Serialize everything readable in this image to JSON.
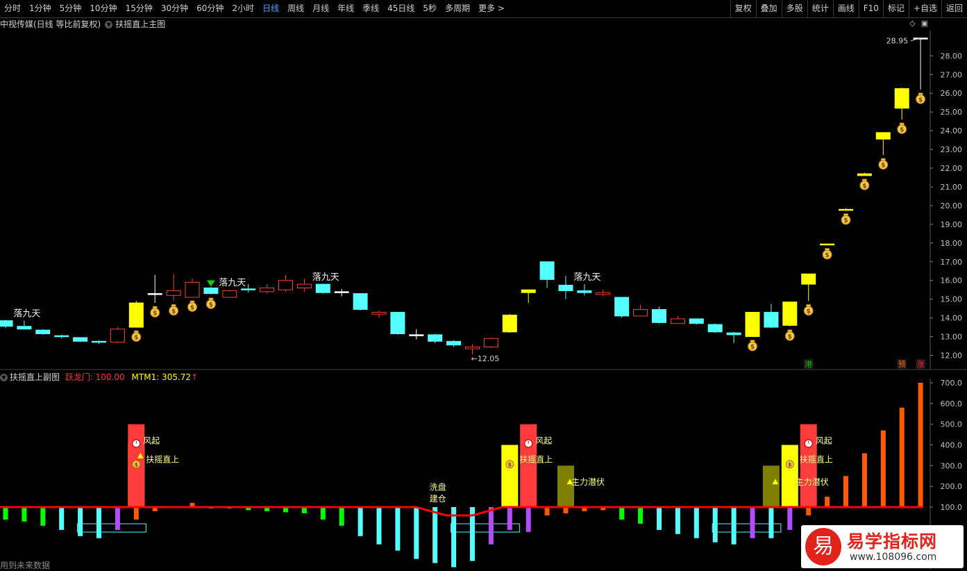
{
  "toolbar": {
    "periods": [
      "分时",
      "1分钟",
      "5分钟",
      "10分钟",
      "15分钟",
      "30分钟",
      "60分钟",
      "2小时",
      "日线",
      "周线",
      "月线",
      "年线",
      "季线",
      "45日线",
      "5秒",
      "多周期",
      "更多 >"
    ],
    "active_index": 8,
    "right_tools": [
      "复权",
      "叠加",
      "多股",
      "统计",
      "画线",
      "F10",
      "标记",
      "+自选",
      "返回"
    ]
  },
  "main_panel": {
    "title": "中视传媒(日线 等比前复权)",
    "indicator": "扶摇直上主图",
    "icons": [
      "diamond-icon",
      "restore-icon"
    ]
  },
  "sub_panel": {
    "title": "扶摇直上副图",
    "val1": "跃龙门: 100.00",
    "val2": "MTM1: 305.72",
    "val2_arrow": "↑"
  },
  "footer_note": "用到未来数据",
  "logo": {
    "char": "易",
    "name": "易学指标网",
    "url": "www.108096.com"
  },
  "colors": {
    "up": "#ff3c3c",
    "down": "#54ffff",
    "yellow": "#ffff00",
    "orange": "#ff5a00",
    "green": "#00ff00",
    "purple": "#b04dff",
    "olive": "#808000",
    "red": "#ff0000",
    "price_axis": "#c0c0c0"
  },
  "chart_data": [
    {
      "type": "candlestick",
      "title": "中视传媒(日线 等比前复权)",
      "ylim": [
        11.5,
        29.2
      ],
      "y_ticks": [
        "12.00",
        "13.00",
        "14.00",
        "15.00",
        "16.00",
        "17.00",
        "18.00",
        "19.00",
        "20.00",
        "21.00",
        "22.00",
        "23.00",
        "24.00",
        "25.00",
        "26.00",
        "27.00",
        "28.00"
      ],
      "candles": [
        {
          "o": 13.85,
          "h": 13.9,
          "l": 13.45,
          "c": 13.55,
          "color": "cyan"
        },
        {
          "o": 13.55,
          "h": 13.85,
          "l": 13.4,
          "c": 13.4,
          "color": "cyan"
        },
        {
          "o": 13.35,
          "h": 13.4,
          "l": 13.1,
          "c": 13.15,
          "color": "cyan"
        },
        {
          "o": 13.05,
          "h": 13.1,
          "l": 12.9,
          "c": 13.0,
          "color": "cyan"
        },
        {
          "o": 12.95,
          "h": 12.95,
          "l": 12.7,
          "c": 12.75,
          "color": "cyan"
        },
        {
          "o": 12.75,
          "h": 12.8,
          "l": 12.6,
          "c": 12.7,
          "color": "cyan"
        },
        {
          "o": 12.7,
          "h": 13.5,
          "l": 12.65,
          "c": 13.4,
          "color": "red"
        },
        {
          "o": 13.5,
          "h": 14.9,
          "l": 13.5,
          "c": 14.8,
          "color": "yellow"
        },
        {
          "o": 15.3,
          "h": 16.3,
          "l": 14.8,
          "c": 15.3,
          "color": "white"
        },
        {
          "o": 15.2,
          "h": 16.35,
          "l": 14.9,
          "c": 15.45,
          "color": "red"
        },
        {
          "o": 15.1,
          "h": 16.1,
          "l": 15.1,
          "c": 15.9,
          "color": "red"
        },
        {
          "o": 15.6,
          "h": 15.65,
          "l": 15.25,
          "c": 15.3,
          "color": "cyan"
        },
        {
          "o": 15.1,
          "h": 15.5,
          "l": 15.1,
          "c": 15.45,
          "color": "red"
        },
        {
          "o": 15.55,
          "h": 15.8,
          "l": 15.35,
          "c": 15.55,
          "color": "cyan"
        },
        {
          "o": 15.4,
          "h": 15.8,
          "l": 15.3,
          "c": 15.6,
          "color": "red"
        },
        {
          "o": 15.5,
          "h": 16.3,
          "l": 15.4,
          "c": 16.0,
          "color": "red"
        },
        {
          "o": 15.6,
          "h": 16.1,
          "l": 15.4,
          "c": 15.8,
          "color": "red"
        },
        {
          "o": 15.8,
          "h": 15.8,
          "l": 15.3,
          "c": 15.35,
          "color": "cyan"
        },
        {
          "o": 15.4,
          "h": 15.55,
          "l": 15.15,
          "c": 15.4,
          "color": "white"
        },
        {
          "o": 15.3,
          "h": 15.3,
          "l": 14.4,
          "c": 14.45,
          "color": "cyan"
        },
        {
          "o": 14.2,
          "h": 14.4,
          "l": 14.0,
          "c": 14.3,
          "color": "red"
        },
        {
          "o": 14.3,
          "h": 14.3,
          "l": 13.1,
          "c": 13.15,
          "color": "cyan"
        },
        {
          "o": 13.1,
          "h": 13.4,
          "l": 12.85,
          "c": 13.1,
          "color": "white"
        },
        {
          "o": 13.1,
          "h": 13.15,
          "l": 12.65,
          "c": 12.75,
          "color": "cyan"
        },
        {
          "o": 12.75,
          "h": 12.8,
          "l": 12.45,
          "c": 12.55,
          "color": "cyan"
        },
        {
          "o": 12.35,
          "h": 12.6,
          "l": 12.05,
          "c": 12.45,
          "color": "red"
        },
        {
          "o": 12.45,
          "h": 12.95,
          "l": 12.4,
          "c": 12.9,
          "color": "red"
        },
        {
          "o": 13.25,
          "h": 14.2,
          "l": 13.2,
          "c": 14.15,
          "color": "yellow"
        },
        {
          "o": 15.35,
          "h": 15.5,
          "l": 14.8,
          "c": 15.5,
          "color": "yellow"
        },
        {
          "o": 17.0,
          "h": 17.0,
          "l": 15.6,
          "c": 16.05,
          "color": "cyan"
        },
        {
          "o": 15.75,
          "h": 16.25,
          "l": 15.0,
          "c": 15.45,
          "color": "cyan"
        },
        {
          "o": 15.45,
          "h": 15.8,
          "l": 15.2,
          "c": 15.35,
          "color": "cyan"
        },
        {
          "o": 15.25,
          "h": 15.5,
          "l": 15.15,
          "c": 15.35,
          "color": "red"
        },
        {
          "o": 15.1,
          "h": 15.1,
          "l": 14.0,
          "c": 14.1,
          "color": "cyan"
        },
        {
          "o": 14.1,
          "h": 14.7,
          "l": 14.1,
          "c": 14.45,
          "color": "red"
        },
        {
          "o": 14.45,
          "h": 14.6,
          "l": 13.7,
          "c": 13.75,
          "color": "cyan"
        },
        {
          "o": 13.7,
          "h": 14.1,
          "l": 13.7,
          "c": 13.95,
          "color": "red"
        },
        {
          "o": 13.95,
          "h": 13.95,
          "l": 13.65,
          "c": 13.7,
          "color": "cyan"
        },
        {
          "o": 13.65,
          "h": 13.7,
          "l": 13.2,
          "c": 13.25,
          "color": "cyan"
        },
        {
          "o": 13.2,
          "h": 13.25,
          "l": 12.65,
          "c": 13.1,
          "color": "cyan"
        },
        {
          "o": 13.0,
          "h": 14.3,
          "l": 13.0,
          "c": 14.3,
          "color": "yellow"
        },
        {
          "o": 14.3,
          "h": 14.75,
          "l": 13.45,
          "c": 13.5,
          "color": "cyan"
        },
        {
          "o": 13.6,
          "h": 14.85,
          "l": 13.55,
          "c": 14.85,
          "color": "yellow"
        },
        {
          "o": 15.8,
          "h": 16.35,
          "l": 14.9,
          "c": 16.35,
          "color": "yellow"
        },
        {
          "o": 17.9,
          "h": 17.95,
          "l": 17.9,
          "c": 17.95,
          "color": "yellow"
        },
        {
          "o": 19.75,
          "h": 19.85,
          "l": 19.75,
          "c": 19.8,
          "color": "yellow"
        },
        {
          "o": 21.6,
          "h": 21.75,
          "l": 21.6,
          "c": 21.7,
          "color": "yellow"
        },
        {
          "o": 23.55,
          "h": 23.9,
          "l": 22.7,
          "c": 23.9,
          "color": "yellow"
        },
        {
          "o": 25.2,
          "h": 26.3,
          "l": 24.6,
          "c": 26.25,
          "color": "yellow"
        },
        {
          "o": 28.95,
          "h": 28.95,
          "l": 26.2,
          "c": 28.95,
          "color": "white"
        }
      ],
      "moneybags": [
        7,
        8,
        9,
        10,
        11,
        40,
        42,
        43,
        44,
        45,
        46,
        47,
        48,
        49
      ],
      "green_arrow_index": 11,
      "annotations": [
        {
          "index": 1,
          "text": "落九天"
        },
        {
          "index": 12,
          "text": "落九天"
        },
        {
          "index": 17,
          "text": "落九天"
        },
        {
          "index": 31,
          "text": "落九天"
        }
      ],
      "low_label": {
        "index": 25,
        "text": "←12.05"
      },
      "high_label": {
        "index": 49,
        "text": "28.95"
      },
      "badges": [
        {
          "index": 43,
          "text": "港",
          "color": "#00c000"
        },
        {
          "index": 48,
          "text": "预",
          "color": "#ff6a00"
        },
        {
          "index": 49,
          "text": "涨",
          "color": "#ff2020"
        }
      ]
    },
    {
      "type": "bar",
      "title": "扶摇直上副图",
      "ylim": [
        -280,
        760
      ],
      "y_ticks": [
        "100.0",
        "200.0",
        "300.0",
        "400.0",
        "500.0",
        "600.0",
        "700.0"
      ],
      "baseline": 100,
      "series": [
        {
          "name": "跃龙门",
          "values": [
            {
              "i": 0,
              "v": -60,
              "c": "green"
            },
            {
              "i": 1,
              "v": -70,
              "c": "green"
            },
            {
              "i": 2,
              "v": -90,
              "c": "green"
            },
            {
              "i": 3,
              "v": -110,
              "c": "cyan"
            },
            {
              "i": 4,
              "v": -140,
              "c": "cyan"
            },
            {
              "i": 5,
              "v": -150,
              "c": "cyan"
            },
            {
              "i": 6,
              "v": -110,
              "c": "purple"
            },
            {
              "i": 7,
              "v": -60,
              "c": "orange"
            },
            {
              "i": 8,
              "v": -20,
              "c": "orange"
            },
            {
              "i": 9,
              "v": 5,
              "c": "orange"
            },
            {
              "i": 10,
              "v": 20,
              "c": "orange"
            },
            {
              "i": 11,
              "v": -3,
              "c": "green"
            },
            {
              "i": 12,
              "v": -3,
              "c": "green"
            },
            {
              "i": 13,
              "v": -15,
              "c": "green"
            },
            {
              "i": 14,
              "v": -20,
              "c": "green"
            },
            {
              "i": 15,
              "v": -25,
              "c": "green"
            },
            {
              "i": 16,
              "v": -30,
              "c": "green"
            },
            {
              "i": 17,
              "v": -60,
              "c": "green"
            },
            {
              "i": 18,
              "v": -90,
              "c": "green"
            },
            {
              "i": 19,
              "v": -140,
              "c": "cyan"
            },
            {
              "i": 20,
              "v": -180,
              "c": "cyan"
            },
            {
              "i": 21,
              "v": -210,
              "c": "cyan"
            },
            {
              "i": 22,
              "v": -250,
              "c": "cyan"
            },
            {
              "i": 23,
              "v": -270,
              "c": "cyan"
            },
            {
              "i": 24,
              "v": -290,
              "c": "cyan"
            },
            {
              "i": 25,
              "v": -260,
              "c": "cyan"
            },
            {
              "i": 26,
              "v": -180,
              "c": "purple"
            },
            {
              "i": 27,
              "v": -110,
              "c": "purple"
            },
            {
              "i": 28,
              "v": -120,
              "c": "purple"
            },
            {
              "i": 29,
              "v": -40,
              "c": "orange"
            },
            {
              "i": 30,
              "v": -30,
              "c": "orange"
            },
            {
              "i": 31,
              "v": -20,
              "c": "orange"
            },
            {
              "i": 32,
              "v": -15,
              "c": "orange"
            },
            {
              "i": 33,
              "v": -60,
              "c": "green"
            },
            {
              "i": 34,
              "v": -80,
              "c": "green"
            },
            {
              "i": 35,
              "v": -110,
              "c": "cyan"
            },
            {
              "i": 36,
              "v": -130,
              "c": "cyan"
            },
            {
              "i": 37,
              "v": -150,
              "c": "cyan"
            },
            {
              "i": 38,
              "v": -170,
              "c": "cyan"
            },
            {
              "i": 39,
              "v": -180,
              "c": "cyan"
            },
            {
              "i": 40,
              "v": -150,
              "c": "purple"
            },
            {
              "i": 41,
              "v": -150,
              "c": "cyan"
            },
            {
              "i": 42,
              "v": -110,
              "c": "purple"
            },
            {
              "i": 43,
              "v": -40,
              "c": "orange"
            },
            {
              "i": 44,
              "v": 50,
              "c": "orange"
            },
            {
              "i": 45,
              "v": 150,
              "c": "orange"
            },
            {
              "i": 46,
              "v": 260,
              "c": "orange"
            },
            {
              "i": 47,
              "v": 370,
              "c": "orange"
            },
            {
              "i": 48,
              "v": 480,
              "c": "orange"
            },
            {
              "i": 49,
              "v": 600,
              "c": "orange"
            }
          ]
        },
        {
          "name": "MTM1",
          "values": [
            {
              "i": 7,
              "v": 300,
              "c": "yellow"
            },
            {
              "i": 27,
              "v": 300,
              "c": "yellow"
            },
            {
              "i": 30,
              "v": 200,
              "c": "olive"
            },
            {
              "i": 41,
              "v": 200,
              "c": "olive"
            },
            {
              "i": 42,
              "v": 300,
              "c": "yellow"
            }
          ]
        },
        {
          "name": "风起",
          "values": [
            {
              "i": 7,
              "v": 400,
              "c": "red"
            },
            {
              "i": 28,
              "v": 400,
              "c": "red"
            },
            {
              "i": 43,
              "v": 400,
              "c": "red"
            }
          ]
        }
      ],
      "annotations": [
        {
          "index": 7,
          "text": "风起",
          "level": 420
        },
        {
          "index": 7,
          "text": "扶摇直上",
          "level": 330
        },
        {
          "index": 28,
          "text": "风起",
          "level": 420
        },
        {
          "index": 27,
          "text": "扶摇直上",
          "level": 330
        },
        {
          "index": 30,
          "text": "主力潜伏",
          "level": 220
        },
        {
          "index": 43,
          "text": "风起",
          "level": 420
        },
        {
          "index": 42,
          "text": "扶摇直上",
          "level": 330
        },
        {
          "index": 42,
          "text": "主力潜伏",
          "level": 220
        },
        {
          "index": 23,
          "text": "洗盘",
          "level": 195
        },
        {
          "index": 23,
          "text": "建仓",
          "level": 140
        }
      ],
      "boxes": [
        [
          4,
          7
        ],
        [
          24,
          27
        ],
        [
          38,
          41
        ]
      ]
    }
  ]
}
